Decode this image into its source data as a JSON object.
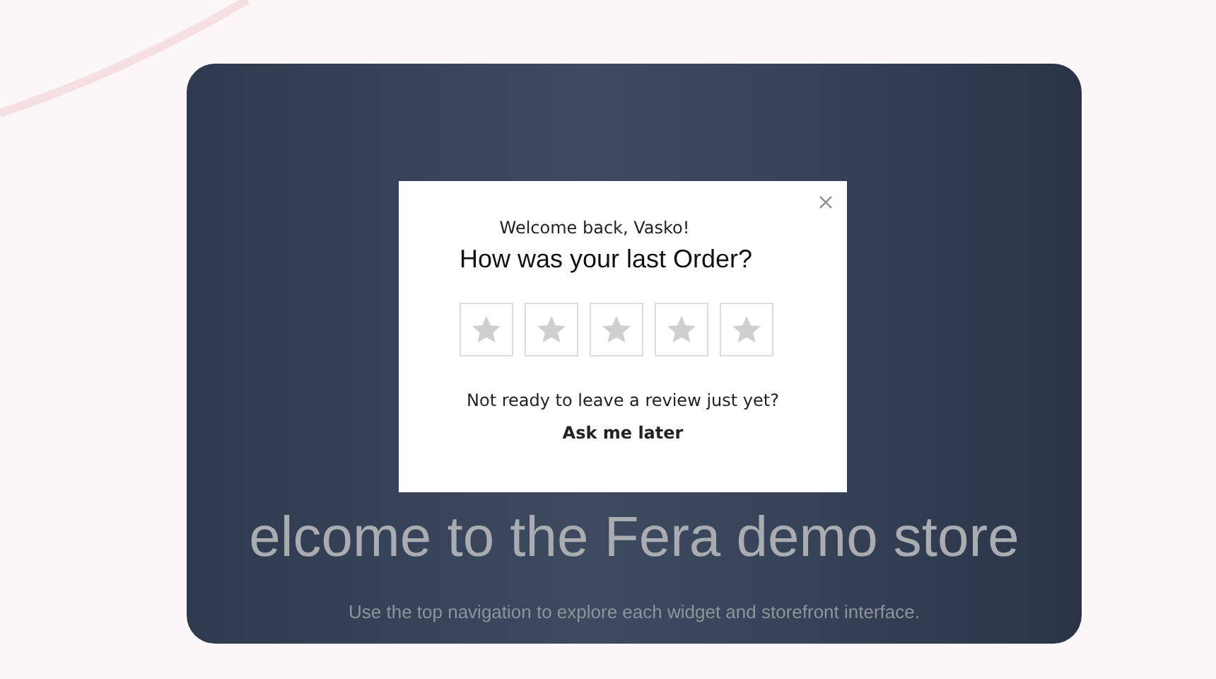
{
  "hero": {
    "title": "elcome to the Fera demo store",
    "subtitle": "Use the top navigation to explore each widget and storefront interface."
  },
  "modal": {
    "greeting": "Welcome back, Vasko!",
    "question": "How was your last Order?",
    "stars": 0,
    "prompt": "Not ready to leave a review just yet?",
    "later_link": "Ask me later"
  }
}
